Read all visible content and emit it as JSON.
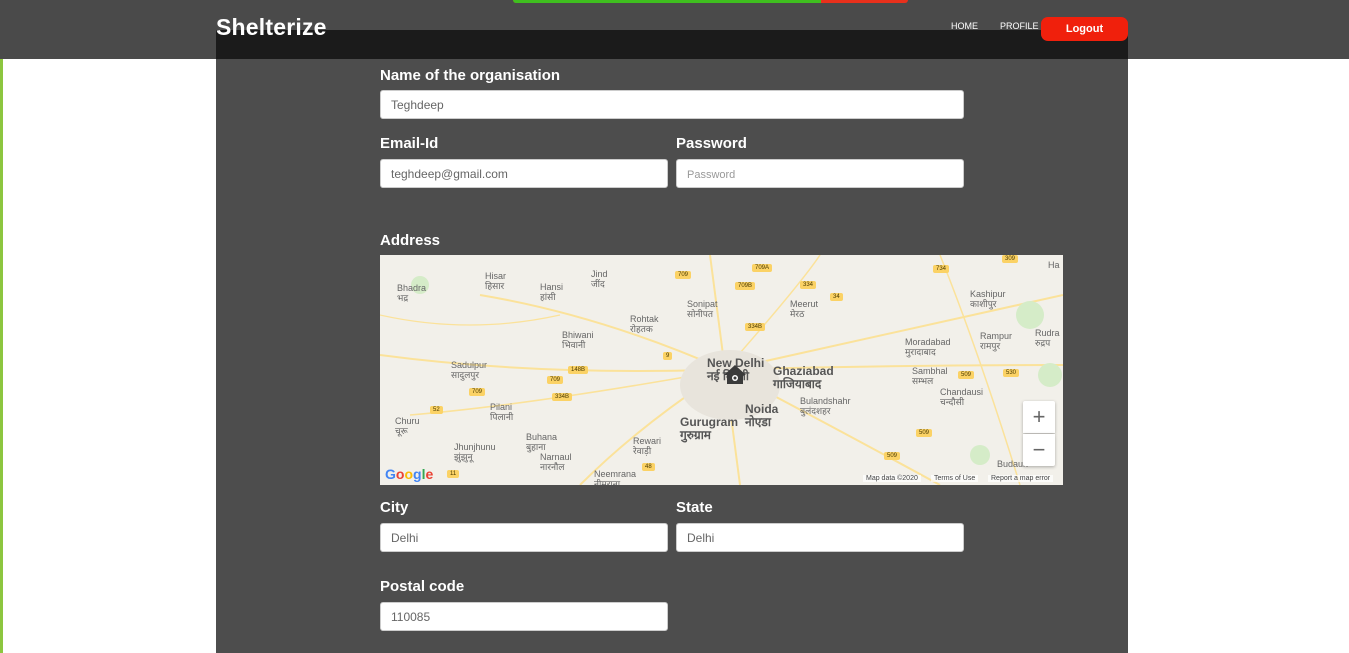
{
  "app": {
    "brand": "Shelterize"
  },
  "nav": {
    "home": "HOME",
    "profile": "PROFILE",
    "logout": "Logout"
  },
  "page_progress": {
    "fraction": 0.78
  },
  "form": {
    "org_name": {
      "label": "Name of the organisation",
      "value": "Teghdeep"
    },
    "email": {
      "label": "Email-Id",
      "value": "teghdeep@gmail.com"
    },
    "password": {
      "label": "Password",
      "placeholder": "Password"
    },
    "address": {
      "label": "Address"
    },
    "city": {
      "label": "City",
      "value": "Delhi"
    },
    "state": {
      "label": "State",
      "value": "Delhi"
    },
    "postal": {
      "label": "Postal code",
      "value": "110085"
    }
  },
  "map": {
    "logo": "Google",
    "map_data": "Map data ©2020",
    "terms": "Terms of Use",
    "report": "Report a map error",
    "zoom_in": "+",
    "zoom_out": "−",
    "places": [
      {
        "name": "Hisar",
        "local": "हिसार"
      },
      {
        "name": "Hansi",
        "local": "हांसी"
      },
      {
        "name": "Jind",
        "local": "जींद"
      },
      {
        "name": "Bhadra",
        "local": "भद्र"
      },
      {
        "name": "Sonipat",
        "local": "सोनीपत"
      },
      {
        "name": "Meerut",
        "local": "मेरठ"
      },
      {
        "name": "Kashipur",
        "local": "काशीपुर"
      },
      {
        "name": "Rohtak",
        "local": "रोहतक"
      },
      {
        "name": "Bhiwani",
        "local": "भिवानी"
      },
      {
        "name": "Rampur",
        "local": "रामपुर"
      },
      {
        "name": "Rudra",
        "local": "रुद्रप"
      },
      {
        "name": "Moradabad",
        "local": "मुरादाबाद"
      },
      {
        "name": "New Delhi",
        "local": "नई दिल्ली"
      },
      {
        "name": "Ghaziabad",
        "local": "गाजियाबाद"
      },
      {
        "name": "Sadulpur",
        "local": "सादुलपुर"
      },
      {
        "name": "Sambhal",
        "local": "सम्भल"
      },
      {
        "name": "Noida",
        "local": "नोएडा"
      },
      {
        "name": "Bulandshahr",
        "local": "बुलंदशहर"
      },
      {
        "name": "Chandausi",
        "local": "चन्दौसी"
      },
      {
        "name": "Pilani",
        "local": "पिलानी"
      },
      {
        "name": "Churu",
        "local": "चूरू"
      },
      {
        "name": "Gurugram",
        "local": "गुरुग्राम"
      },
      {
        "name": "Buhana",
        "local": "बुहाना"
      },
      {
        "name": "Rewari",
        "local": "रेवाड़ी"
      },
      {
        "name": "Jhunjhunu",
        "local": "झुंझुनू"
      },
      {
        "name": "Narnaul",
        "local": "नारनौल"
      },
      {
        "name": "Neemrana",
        "local": "नीमराना"
      },
      {
        "name": "Budaun",
        "local": ""
      },
      {
        "name": "Ha",
        "local": ""
      }
    ],
    "shields": [
      "709",
      "709A",
      "334",
      "734",
      "309",
      "709B",
      "34",
      "334B",
      "9",
      "148B",
      "709",
      "709",
      "334B",
      "52",
      "48",
      "11",
      "509",
      "530",
      "509",
      "509"
    ]
  }
}
